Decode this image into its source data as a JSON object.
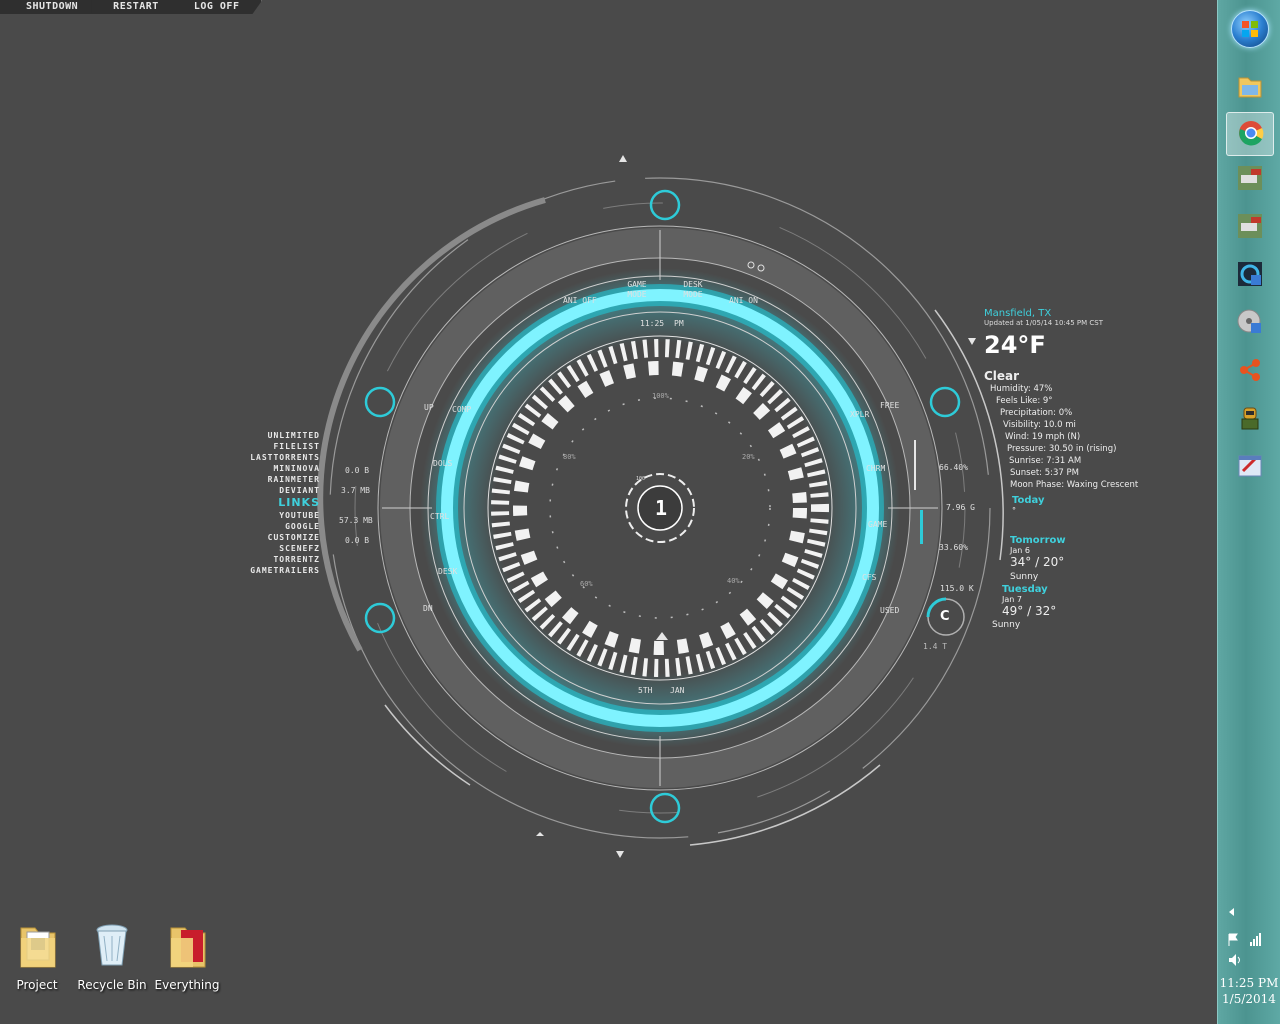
{
  "topbar": {
    "buttons": [
      "SHUTDOWN",
      "RESTART",
      "LOG OFF"
    ]
  },
  "hud": {
    "top_buttons": [
      "ANI OFF",
      "GAME MODE",
      "DESK MODE",
      "ANI ON"
    ],
    "left_buttons": [
      "UP",
      "COMP",
      "DOLS",
      "CTRL",
      "DESK",
      "DN"
    ],
    "right_buttons": [
      "FREE",
      "XPLR",
      "CHRM",
      "GAME",
      "CFS",
      "USED"
    ],
    "time_label": "11:25",
    "ampm_label": "PM",
    "day_label": "5TH",
    "month_label": "JAN",
    "center_digit": "1",
    "center_top_small": "100",
    "percent_labels": [
      "100%",
      "80%",
      "20%",
      "60%",
      "40%"
    ],
    "drive_letter": "C",
    "drive_total": "1.4 T",
    "stats": [
      "66.40%",
      "7.96 G",
      "33.60%",
      "115.0 K"
    ]
  },
  "network": {
    "values": [
      "0.0 B",
      "3.7 MB",
      "57.3 MB",
      "0.0 B"
    ]
  },
  "links": {
    "items_top": [
      "UNLIMITED",
      "FILELIST",
      "LASTTORRENTS",
      "MININOVA",
      "RAINMETER",
      "DEVIANT"
    ],
    "title": "LINKS",
    "items_bottom": [
      "YOUTUBE",
      "GOOGLE",
      "CUSTOMIZE",
      "SCENEFZ",
      "TORRENTZ",
      "GAMETRAILERS"
    ]
  },
  "weather": {
    "city": "Mansfield, TX",
    "updated": "Updated at 1/05/14 10:45 PM CST",
    "temp": "24°F",
    "condition": "Clear",
    "details": [
      "Humidity: 47%",
      "Feels Like: 9°",
      "Precipitation: 0%",
      "Visibility: 10.0 mi",
      "Wind: 19 mph (N)",
      "Pressure: 30.50 in (rising)",
      "Sunrise: 7:31 AM",
      "Sunset: 5:37 PM",
      "Moon Phase: Waxing Crescent"
    ],
    "today_label": "Today",
    "today_temp": "°",
    "tomorrow_label": "Tomorrow",
    "tomorrow_date": "Jan 6",
    "tomorrow_temp": "34° / 20°",
    "tomorrow_desc": "Sunny",
    "tuesday_label": "Tuesday",
    "tuesday_date": "Jan 7",
    "tuesday_temp": "49° / 32°",
    "tuesday_desc": "Sunny"
  },
  "desktop_icons": [
    {
      "label": "Project",
      "icon": "folder-icon"
    },
    {
      "label": "Recycle Bin",
      "icon": "recycle-bin-icon"
    },
    {
      "label": "Everything",
      "icon": "folder-icon"
    }
  ],
  "taskbar": {
    "icons": [
      "start-orb",
      "explorer-icon",
      "chrome-icon",
      "game-icon",
      "game-icon",
      "rainmeter-icon",
      "disc-settings-icon",
      "network-icon",
      "robot-icon",
      "paint-icon"
    ],
    "clock_time": "11:25 PM",
    "clock_date": "1/5/2014"
  },
  "colors": {
    "accent": "#3fd0dc",
    "background": "#4a4a4a",
    "taskbar": "#55a09c"
  }
}
